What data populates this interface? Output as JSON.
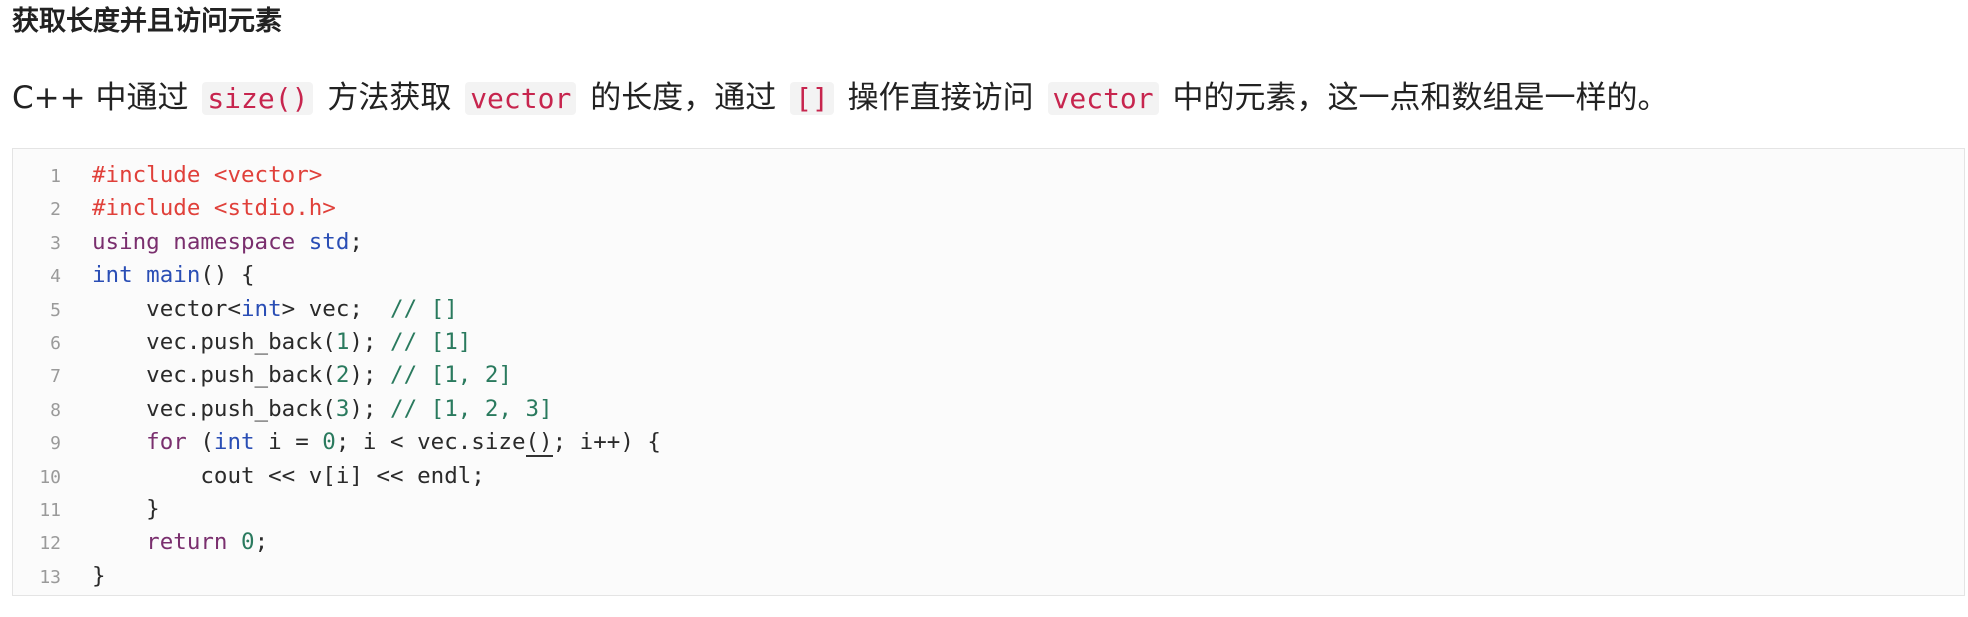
{
  "section_title": "获取长度并且访问元素",
  "description": {
    "prefix": "C++ 中通过",
    "code_size": "size()",
    "mid1": "方法获取",
    "code_vector1": "vector",
    "mid2": "的长度，通过",
    "code_brackets": "[]",
    "mid3": "操作直接访问",
    "code_vector2": "vector",
    "suffix": "中的元素，这一点和数组是一样的。"
  },
  "code": {
    "line_numbers": [
      "1",
      "2",
      "3",
      "4",
      "5",
      "6",
      "7",
      "8",
      "9",
      "10",
      "11",
      "12",
      "13"
    ],
    "lines": [
      [
        {
          "t": "pre",
          "v": "#include <vector>"
        }
      ],
      [
        {
          "t": "pre",
          "v": "#include <stdio.h>"
        }
      ],
      [
        {
          "t": "kw",
          "v": "using namespace "
        },
        {
          "t": "type",
          "v": "std"
        },
        {
          "t": "plain",
          "v": ";"
        }
      ],
      [
        {
          "t": "type",
          "v": "int main"
        },
        {
          "t": "plain",
          "v": "() {"
        }
      ],
      [
        {
          "t": "plain",
          "v": "    vector<"
        },
        {
          "t": "type",
          "v": "int"
        },
        {
          "t": "plain",
          "v": "> vec;  "
        },
        {
          "t": "com",
          "v": "// []"
        }
      ],
      [
        {
          "t": "plain",
          "v": "    vec.push_back("
        },
        {
          "t": "num",
          "v": "1"
        },
        {
          "t": "plain",
          "v": "); "
        },
        {
          "t": "com",
          "v": "// [1]"
        }
      ],
      [
        {
          "t": "plain",
          "v": "    vec.push_back("
        },
        {
          "t": "num",
          "v": "2"
        },
        {
          "t": "plain",
          "v": "); "
        },
        {
          "t": "com",
          "v": "// [1, 2]"
        }
      ],
      [
        {
          "t": "plain",
          "v": "    vec.push_back("
        },
        {
          "t": "num",
          "v": "3"
        },
        {
          "t": "plain",
          "v": "); "
        },
        {
          "t": "com",
          "v": "// [1, 2, 3]"
        }
      ],
      [
        {
          "t": "kw",
          "v": "    for "
        },
        {
          "t": "plain",
          "v": "("
        },
        {
          "t": "type",
          "v": "int"
        },
        {
          "t": "plain",
          "v": " i = "
        },
        {
          "t": "num",
          "v": "0"
        },
        {
          "t": "plain",
          "v": "; i < vec.size"
        },
        {
          "t": "caret",
          "v": "()"
        },
        {
          "t": "plain",
          "v": "; i++) {"
        }
      ],
      [
        {
          "t": "plain",
          "v": "        cout << v[i] << endl;"
        }
      ],
      [
        {
          "t": "plain",
          "v": "    }"
        }
      ],
      [
        {
          "t": "kw",
          "v": "    return "
        },
        {
          "t": "num",
          "v": "0"
        },
        {
          "t": "plain",
          "v": ";"
        }
      ],
      [
        {
          "t": "plain",
          "v": "}"
        }
      ]
    ]
  }
}
